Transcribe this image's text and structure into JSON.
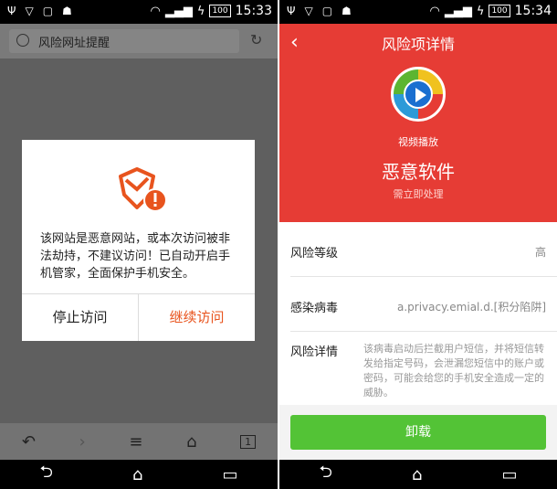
{
  "left": {
    "status": {
      "icons": [
        "usb-icon",
        "shield-icon",
        "image-icon",
        "android-icon"
      ],
      "battery": "100",
      "time": "15:33"
    },
    "url_title": "风险网址提醒",
    "dialog": {
      "message": "该网站是恶意网站，或本次访问被非法劫持，不建议访问！已自动开启手机管家，全面保护手机安全。",
      "stop_label": "停止访问",
      "continue_label": "继续访问"
    },
    "toolbar": {
      "back": "↶",
      "forward": "›",
      "menu": "≡",
      "home": "⌂",
      "tabs": "1"
    },
    "nav": {
      "back": "⮌",
      "home": "⌂",
      "recent": "▭"
    }
  },
  "right": {
    "status": {
      "battery": "100",
      "time": "15:34"
    },
    "title": "风险项详情",
    "back_icon": "‹",
    "app_name": "视频播放",
    "threat_type": "恶意软件",
    "action_hint": "需立即处理",
    "rows": [
      {
        "label": "风险等级",
        "value": "高"
      },
      {
        "label": "感染病毒",
        "value": "a.privacy.emial.d.[积分陷阱]"
      },
      {
        "label": "风险详情",
        "value": "该病毒启动后拦截用户短信，并将短信转发给指定号码，会泄漏您短信中的账户或密码，可能会给您的手机安全造成一定的威胁。"
      }
    ],
    "uninstall_label": "卸载"
  },
  "colors": {
    "danger_red": "#e63c35",
    "accent_orange": "#e8541e",
    "uninstall_green": "#53c336"
  }
}
